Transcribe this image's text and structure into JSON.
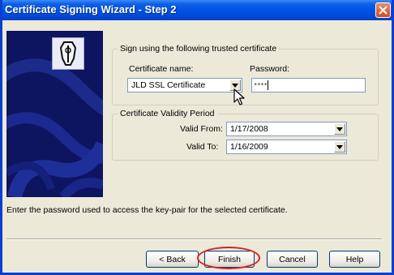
{
  "window": {
    "title": "Certificate Signing Wizard - Step 2"
  },
  "icons": {
    "close": "close-icon",
    "logo": "certificate-wizard-logo-icon",
    "dropdown": "chevron-down-icon",
    "cursor": "mouse-pointer-icon"
  },
  "certificate_group": {
    "legend": "Sign using the following trusted certificate",
    "name_label": "Certificate name:",
    "name_value": "JLD SSL Certificate",
    "password_label": "Password:",
    "password_value": "****"
  },
  "validity_group": {
    "legend": "Certificate Validity Period",
    "from_label": "Valid From:",
    "from_value": "1/17/2008",
    "to_label": "Valid To:",
    "to_value": "1/16/2009"
  },
  "description": "Enter the password used to access the key-pair for the selected certificate.",
  "buttons": {
    "back": "< Back",
    "finish": "Finish",
    "cancel": "Cancel",
    "help": "Help"
  },
  "colors": {
    "titlebar": "#0052e3",
    "dialog_bg": "#ece9d8",
    "sidebar": "#0d1560",
    "highlight": "#d42222"
  }
}
